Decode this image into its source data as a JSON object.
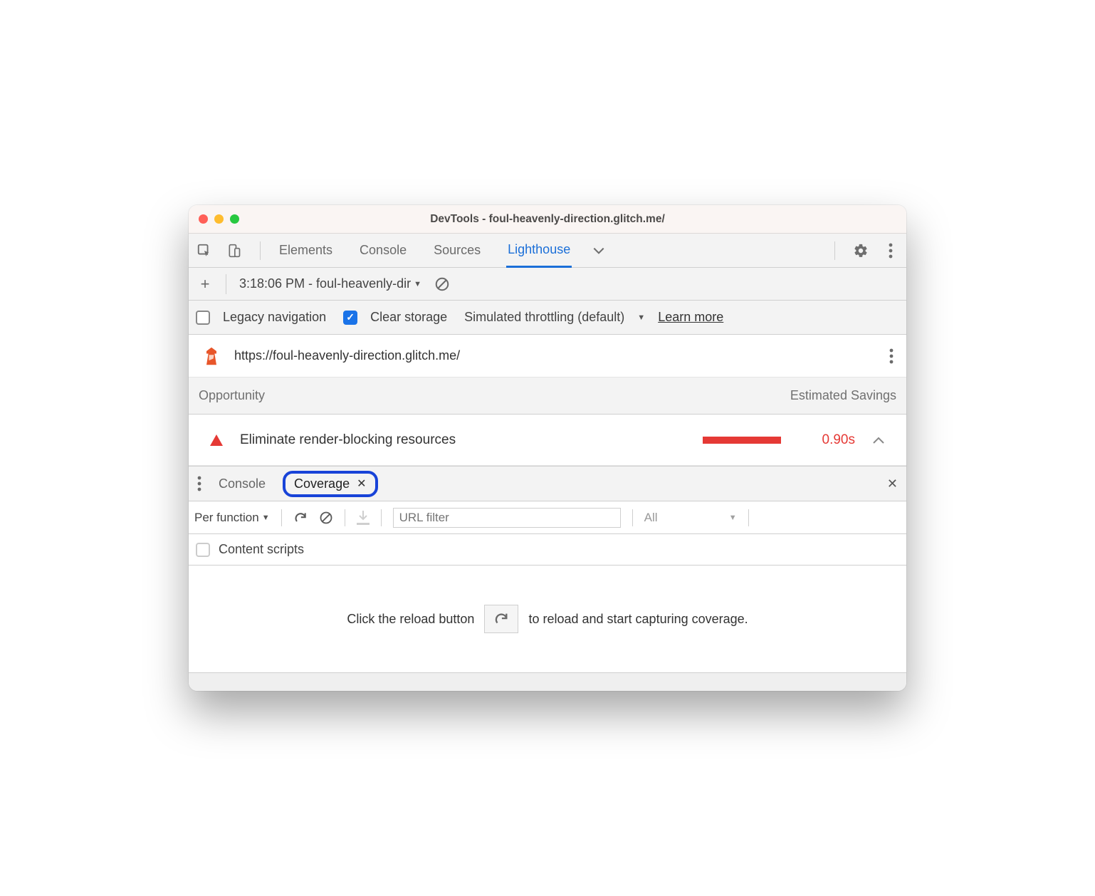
{
  "window": {
    "title": "DevTools - foul-heavenly-direction.glitch.me/"
  },
  "main_tabs": {
    "items": [
      "Elements",
      "Console",
      "Sources",
      "Lighthouse"
    ],
    "active": "Lighthouse"
  },
  "options": {
    "run_dropdown": "3:18:06 PM - foul-heavenly-dir"
  },
  "settings_row": {
    "legacy_nav_label": "Legacy navigation",
    "legacy_nav_checked": false,
    "clear_storage_label": "Clear storage",
    "clear_storage_checked": true,
    "throttling_label": "Simulated throttling (default)",
    "learn_more": "Learn more"
  },
  "lighthouse": {
    "url": "https://foul-heavenly-direction.glitch.me/",
    "table_header_left": "Opportunity",
    "table_header_right": "Estimated Savings",
    "audit": {
      "title": "Eliminate render-blocking resources",
      "savings": "0.90s"
    }
  },
  "drawer": {
    "tabs": [
      "Console",
      "Coverage"
    ],
    "active": "Coverage"
  },
  "coverage": {
    "granularity": "Per function",
    "url_filter_placeholder": "URL filter",
    "type_filter": "All",
    "content_scripts_label": "Content scripts",
    "empty_pre": "Click the reload button",
    "empty_post": "to reload and start capturing coverage."
  }
}
